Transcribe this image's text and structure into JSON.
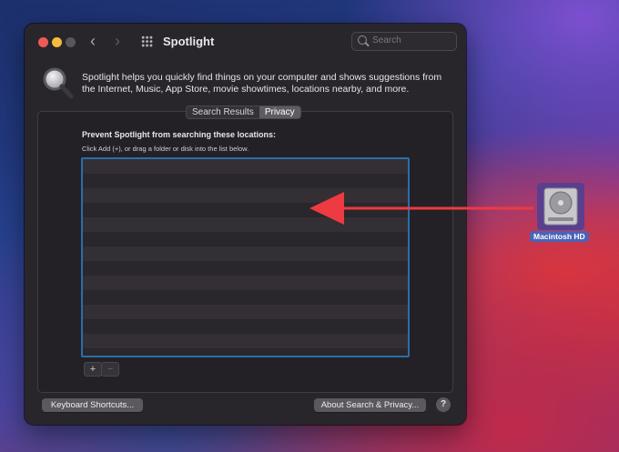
{
  "window": {
    "title": "Spotlight",
    "search_placeholder": "Search",
    "description": "Spotlight helps you quickly find things on your computer and shows suggestions from the Internet, Music, App Store, movie showtimes, locations nearby, and more.",
    "tabs": [
      {
        "label": "Search Results",
        "active": false
      },
      {
        "label": "Privacy",
        "active": true
      }
    ],
    "privacy": {
      "heading": "Prevent Spotlight from searching these locations:",
      "subheading": "Click Add (+), or drag a folder or disk into the list below.",
      "add_label": "+",
      "remove_label": "−"
    },
    "buttons": {
      "keyboard_shortcuts": "Keyboard Shortcuts...",
      "about_search_privacy": "About Search & Privacy...",
      "help": "?"
    }
  },
  "desktop": {
    "disk_label": "Macintosh HD"
  },
  "colors": {
    "arrow": "#ee3a41",
    "list_border": "#2a6ea8"
  }
}
